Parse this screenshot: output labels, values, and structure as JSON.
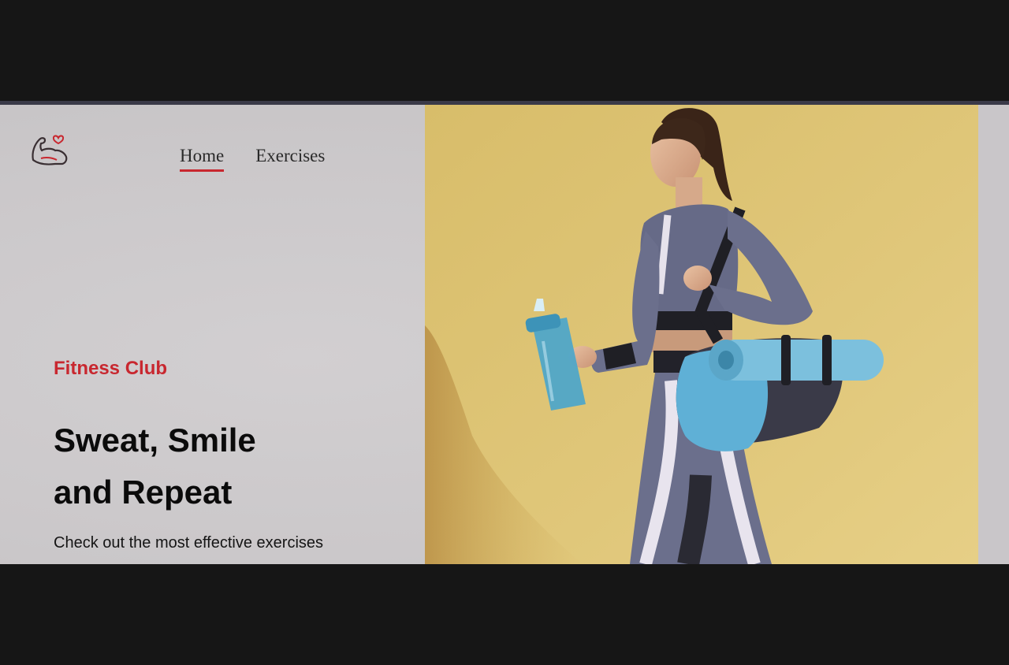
{
  "header": {
    "logo_icon": "flexed-arm-heart-icon",
    "nav": [
      {
        "label": "Home",
        "active": true
      },
      {
        "label": "Exercises",
        "active": false
      }
    ]
  },
  "hero": {
    "kicker": "Fitness Club",
    "headline_line1": "Sweat, Smile",
    "headline_line2": "and Repeat",
    "subline": "Check out the most effective exercises",
    "image_icon": "woman-with-shaker-and-yoga-mat-photo"
  },
  "colors": {
    "accent": "#c8272f",
    "hero_background": "#d9bf6c",
    "left_panel": "#cbc8ca",
    "outside_frame": "#161616"
  }
}
